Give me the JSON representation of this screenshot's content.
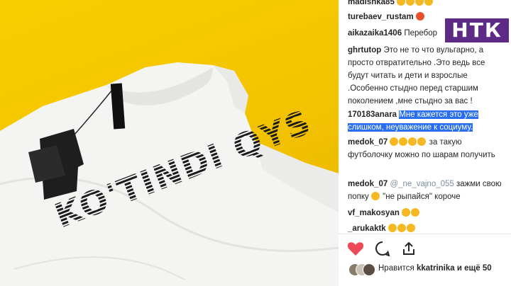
{
  "photo": {
    "print_text": "KO'TINDI QYS"
  },
  "logo": {
    "text": "НТК"
  },
  "comments": [
    {
      "user": "madishka85",
      "text": "",
      "emoji_count": 4
    },
    {
      "user": "turebaev_rustam",
      "text": "",
      "emoji_count": 1,
      "emoji_color": "red"
    },
    {
      "user": "aikazaika1406",
      "text": "Перебор"
    },
    {
      "user": "ghrtutop",
      "text": "Это не то что вульгарно, а просто отвратительно .Это ведь все будут читать и дети и взрослые .Особенно стыдно перед старшим поколением ,мне стыдно за вас !"
    },
    {
      "user": "170183anara",
      "text": "Мне кажется это уже слишком, неуважение к социуму.",
      "highlighted": true
    },
    {
      "user": "medok_07",
      "text": "за такую футболочку можно по шарам получить",
      "emoji_count": 4
    },
    {
      "user": "medok_07",
      "mention": "@_ne_vajno_055",
      "text": "зажми свою попку",
      "text2": "\"не рыпайся\" короче"
    },
    {
      "user": "vf_makosyan",
      "text": "",
      "emoji_count": 2
    },
    {
      "user": "_аrukaktk",
      "text": "",
      "emoji_count": 3
    }
  ],
  "actions": {
    "like_icon": "heart-icon",
    "comment_icon": "comment-icon",
    "share_icon": "share-icon"
  },
  "likes": {
    "prefix": "Нравится",
    "user": "kkatrinika",
    "suffix": "и ещё 50"
  },
  "colors": {
    "highlight": "#2a6ef0",
    "logo": "#5d2b86",
    "heart": "#ed4956",
    "background": "#f3c200"
  }
}
